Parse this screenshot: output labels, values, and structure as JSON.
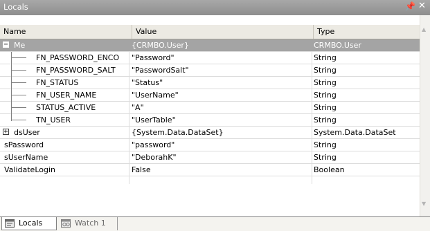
{
  "panel": {
    "title": "Locals",
    "pin_glyph": " ᴨ ",
    "close_glyph": "✕"
  },
  "columns": {
    "name": "Name",
    "value": "Value",
    "type": "Type"
  },
  "rows": [
    {
      "name": "Me",
      "value": "{CRMBO.User}",
      "type": "CRMBO.User",
      "expander": "−"
    },
    {
      "name": "FN_PASSWORD_ENCO",
      "value": "\"Password\"",
      "type": "String"
    },
    {
      "name": "FN_PASSWORD_SALT",
      "value": "\"PasswordSalt\"",
      "type": "String"
    },
    {
      "name": "FN_STATUS",
      "value": "\"Status\"",
      "type": "String"
    },
    {
      "name": "FN_USER_NAME",
      "value": "\"UserName\"",
      "type": "String"
    },
    {
      "name": "STATUS_ACTIVE",
      "value": "\"A\"",
      "type": "String"
    },
    {
      "name": "TN_USER",
      "value": "\"UserTable\"",
      "type": "String"
    },
    {
      "name": "dsUser",
      "value": "{System.Data.DataSet}",
      "type": "System.Data.DataSet",
      "expander": "+"
    },
    {
      "name": "sPassword",
      "value": "\"password\"",
      "type": "String"
    },
    {
      "name": "sUserName",
      "value": "\"DeborahK\"",
      "type": "String"
    },
    {
      "name": "ValidateLogin",
      "value": "False",
      "type": "Boolean"
    }
  ],
  "tabs": {
    "locals": "Locals",
    "watch": "Watch 1"
  },
  "colors": {
    "titlebar": "#8e8e8e",
    "selected_row": "#a4a4a4",
    "header": "#eceae3"
  }
}
